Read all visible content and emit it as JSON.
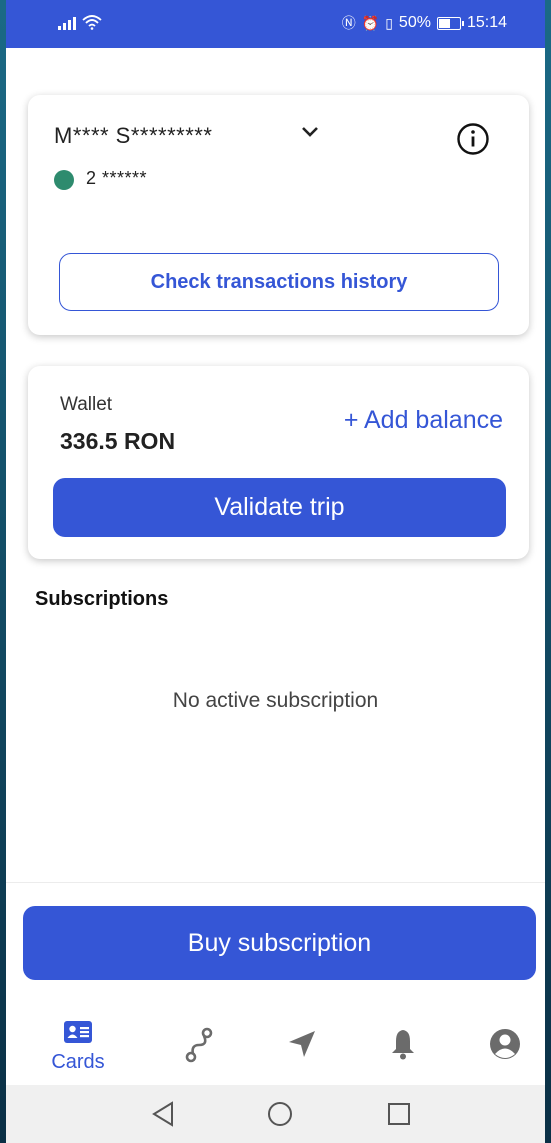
{
  "status_bar": {
    "battery": "50%",
    "time": "15:14"
  },
  "card": {
    "holder_name": "M**** S*********",
    "card_number": "2 ******",
    "history_button": "Check transactions history"
  },
  "wallet": {
    "label": "Wallet",
    "amount": "336.5 RON",
    "add_balance": "+ Add balance",
    "validate_button": "Validate trip"
  },
  "subscriptions": {
    "heading": "Subscriptions",
    "empty_text": "No active subscription",
    "buy_button": "Buy subscription"
  },
  "bottom_nav": {
    "cards_label": "Cards",
    "active_color": "#3556d6",
    "icons": [
      "id-card-icon",
      "route-icon",
      "location-arrow-icon",
      "bell-icon",
      "user-circle-icon"
    ]
  },
  "colors": {
    "accent": "#3556d6",
    "card_status": "#2e8b6e"
  }
}
